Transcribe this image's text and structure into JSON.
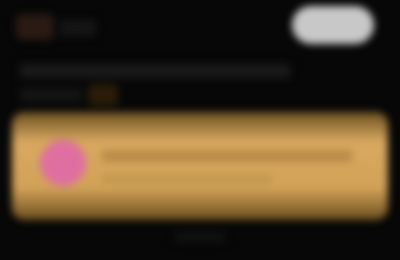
{
  "header": {
    "title": "",
    "action_label": ""
  },
  "section": {
    "text": "",
    "title": ""
  },
  "banner": {
    "title": "",
    "subtitle": ""
  },
  "footer": {
    "hint": ""
  },
  "colors": {
    "background": "#070707",
    "banner_accent": "#d8a860",
    "banner_icon": "#df6fa0",
    "header_button": "#c8c8c8"
  },
  "icons": {
    "logo": "app-logo",
    "section_chevron": "chevron-icon",
    "banner_icon": "app-icon"
  }
}
